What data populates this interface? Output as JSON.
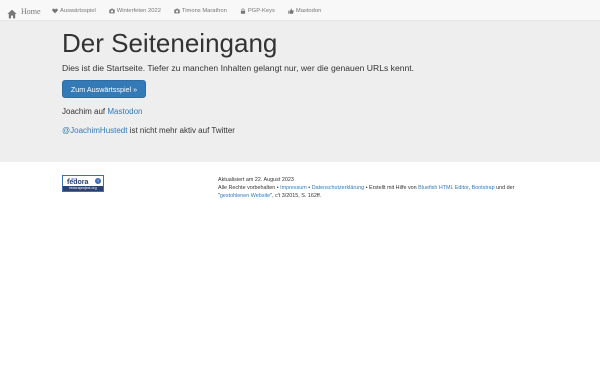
{
  "navbar": {
    "brand": {
      "icon": "home-icon",
      "label": "Home"
    },
    "items": [
      {
        "icon": "heart-icon",
        "label": "Auswärtsspiel"
      },
      {
        "icon": "camera-icon",
        "label": "Winterfeten 2022"
      },
      {
        "icon": "camera-icon",
        "label": "Timons Marathon"
      },
      {
        "icon": "lock-icon",
        "label": "PGP-Keys"
      },
      {
        "icon": "thumbs-up-icon",
        "label": "Mastodon"
      }
    ]
  },
  "jumbotron": {
    "title": "Der Seiteneingang",
    "lead": "Dies ist die Startseite. Tiefer zu manchen Inhalten gelangt nur, wer die genauen URLs kennt.",
    "cta": "Zum Auswärtsspiel »",
    "mastodon_prefix": "Joachim auf ",
    "mastodon_link": "Mastodon",
    "twitter_link": "@JoachimHustedt",
    "twitter_suffix": " ist nicht mehr aktiv auf Twitter"
  },
  "footer": {
    "badge": {
      "top": "i am",
      "name": "fedora",
      "mark": "f",
      "bar": "fedoraproject.org"
    },
    "updated": "Aktualisiert am 22. August 2023",
    "rights_prefix": "Alle Rechte vorbehalten • ",
    "impressum": "Impressum",
    "sep1": " • ",
    "datenschutz": "Datenschutzerklärung",
    "made_with": " • Erstellt mit Hilfe von ",
    "bluefish": "Bluefish HTML Editor",
    "comma": ", ",
    "bootstrap": "Bootstrap",
    "and_the": " und der",
    "quote_open": "\"",
    "stolen_site": "gestohlenen Website",
    "citation": "\", c't 3/2015, S. 162ff."
  },
  "colors": {
    "link": "#337ab7",
    "button": "#337ab7",
    "jumbotron_bg": "#eeeeee",
    "navbar_bg": "#f8f8f8"
  }
}
